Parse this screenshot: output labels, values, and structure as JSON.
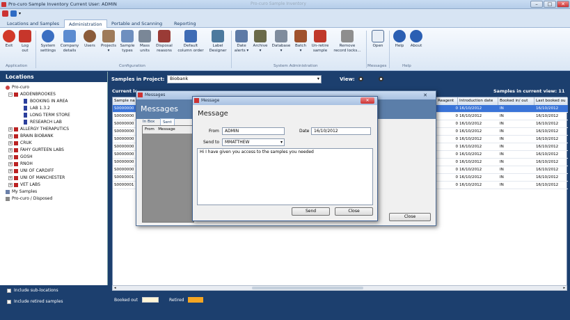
{
  "app": {
    "title": "Pro-curo Sample Inventory  Current User: ADMIN",
    "center_title": "Pro-curo  Sample Inventory",
    "window_controls": [
      "–",
      "□",
      "✕"
    ]
  },
  "tabs": [
    "Locations and Samples",
    "Administration",
    "Portable and Scanning",
    "Reporting"
  ],
  "active_tab": "Administration",
  "ribbon": {
    "groups": [
      {
        "label": "Application",
        "buttons": [
          "Exit",
          "Log\nout"
        ]
      },
      {
        "label": "Configuration",
        "buttons": [
          "System\nsettings",
          "Company\ndetails",
          "Users",
          "Projects\n▾",
          "Sample\ntypes",
          "Mass\nunits",
          "Disposal\nreasons",
          "Default\ncolumn order",
          "Label\nDesigner"
        ]
      },
      {
        "label": "System Administration",
        "buttons": [
          "Date\nalerts ▾",
          "Archive\n▾",
          "Database\n▾",
          "Batch\n▾",
          "Un-retire\nsample",
          "Remove\nrecord locks..."
        ]
      },
      {
        "label": "Messages",
        "buttons": [
          "Open"
        ]
      },
      {
        "label": "Help",
        "buttons": [
          "Help",
          "About"
        ]
      }
    ]
  },
  "left_panel": {
    "header": "Locations",
    "tree": [
      {
        "label": "Pro-curo",
        "level": 0,
        "type": "root"
      },
      {
        "label": "ADDENBROOKES",
        "level": 1,
        "type": "facility",
        "expander": "−"
      },
      {
        "label": "BOOKING IN AREA",
        "level": 2,
        "type": "box"
      },
      {
        "label": "LAB 1.3.2",
        "level": 2,
        "type": "box"
      },
      {
        "label": "LONG TERM STORE",
        "level": 2,
        "type": "box"
      },
      {
        "label": "RESEARCH LAB",
        "level": 2,
        "type": "box"
      },
      {
        "label": "ALLERGY THERAPUTICS",
        "level": 1,
        "type": "facility",
        "expander": "+"
      },
      {
        "label": "BRAIN BIOBANK",
        "level": 1,
        "type": "facility",
        "expander": "+"
      },
      {
        "label": "CRUK",
        "level": 1,
        "type": "facility",
        "expander": "+"
      },
      {
        "label": "FAHY GURTEEN LABS",
        "level": 1,
        "type": "facility",
        "expander": "+"
      },
      {
        "label": "GOSH",
        "level": 1,
        "type": "facility",
        "expander": "+"
      },
      {
        "label": "RNOH",
        "level": 1,
        "type": "facility",
        "expander": "+"
      },
      {
        "label": "UNI OF CARDIFF",
        "level": 1,
        "type": "facility",
        "expander": "+"
      },
      {
        "label": "UNI OF MANCHESTER",
        "level": 1,
        "type": "facility",
        "expander": "+"
      },
      {
        "label": "VET LABS",
        "level": 1,
        "type": "facility",
        "expander": "+"
      },
      {
        "label": "My Samples",
        "level": 0,
        "type": "special"
      },
      {
        "label": "Pro-curo / Disposed",
        "level": 0,
        "type": "special"
      }
    ],
    "checkboxes": [
      "Include sub-locations",
      "Include retired samples"
    ]
  },
  "main": {
    "project_label": "Samples in Project:",
    "project_value": "Biobank",
    "view_label": "View:",
    "current_label": "Current lo",
    "samples_count": "Samples in current view: 11",
    "legend": [
      {
        "label": "Booked out",
        "color": "#fff6d8"
      },
      {
        "label": "Retired",
        "color": "#f5a623"
      }
    ],
    "grid": {
      "headers": [
        "Sample na",
        "Reagent",
        "Introduction date",
        "Booked in/ out",
        "Last booked ou"
      ],
      "rows": [
        [
          "S0000000",
          "0",
          "16/10/2012",
          "IN",
          "16/10/2012"
        ],
        [
          "S0000000",
          "0",
          "16/10/2012",
          "IN",
          "16/10/2012"
        ],
        [
          "S0000000",
          "0",
          "16/10/2012",
          "IN",
          "16/10/2012"
        ],
        [
          "S0000000",
          "0",
          "16/10/2012",
          "IN",
          "16/10/2012"
        ],
        [
          "S0000000",
          "0",
          "16/10/2012",
          "IN",
          "16/10/2012"
        ],
        [
          "S0000000",
          "0",
          "16/10/2012",
          "IN",
          "16/10/2012"
        ],
        [
          "S0000000",
          "0",
          "16/10/2012",
          "IN",
          "16/10/2012"
        ],
        [
          "S0000000",
          "0",
          "16/10/2012",
          "IN",
          "16/10/2012"
        ],
        [
          "S0000000",
          "0",
          "16/10/2012",
          "IN",
          "16/10/2012"
        ],
        [
          "S0000001",
          "0",
          "16/10/2012",
          "IN",
          "16/10/2012"
        ],
        [
          "S0000001",
          "0",
          "16/10/2012",
          "IN",
          "16/10/2012"
        ]
      ]
    }
  },
  "messages_window": {
    "title": "Messages",
    "heading": "Messages",
    "tabs": [
      "In Box",
      "Sent"
    ],
    "columns": [
      "From",
      "Message"
    ],
    "close_label": "Close",
    "close_x": "✕"
  },
  "message_dialog": {
    "title": "Message",
    "heading": "Message",
    "from_label": "From",
    "from_value": "ADMIN",
    "date_label": "Date",
    "date_value": "16/10/2012",
    "sendto_label": "Send to",
    "sendto_value": "MMATTHEW",
    "body": "Hi I have given you access to the samples you needed",
    "send_label": "Send",
    "close_label": "Close"
  }
}
